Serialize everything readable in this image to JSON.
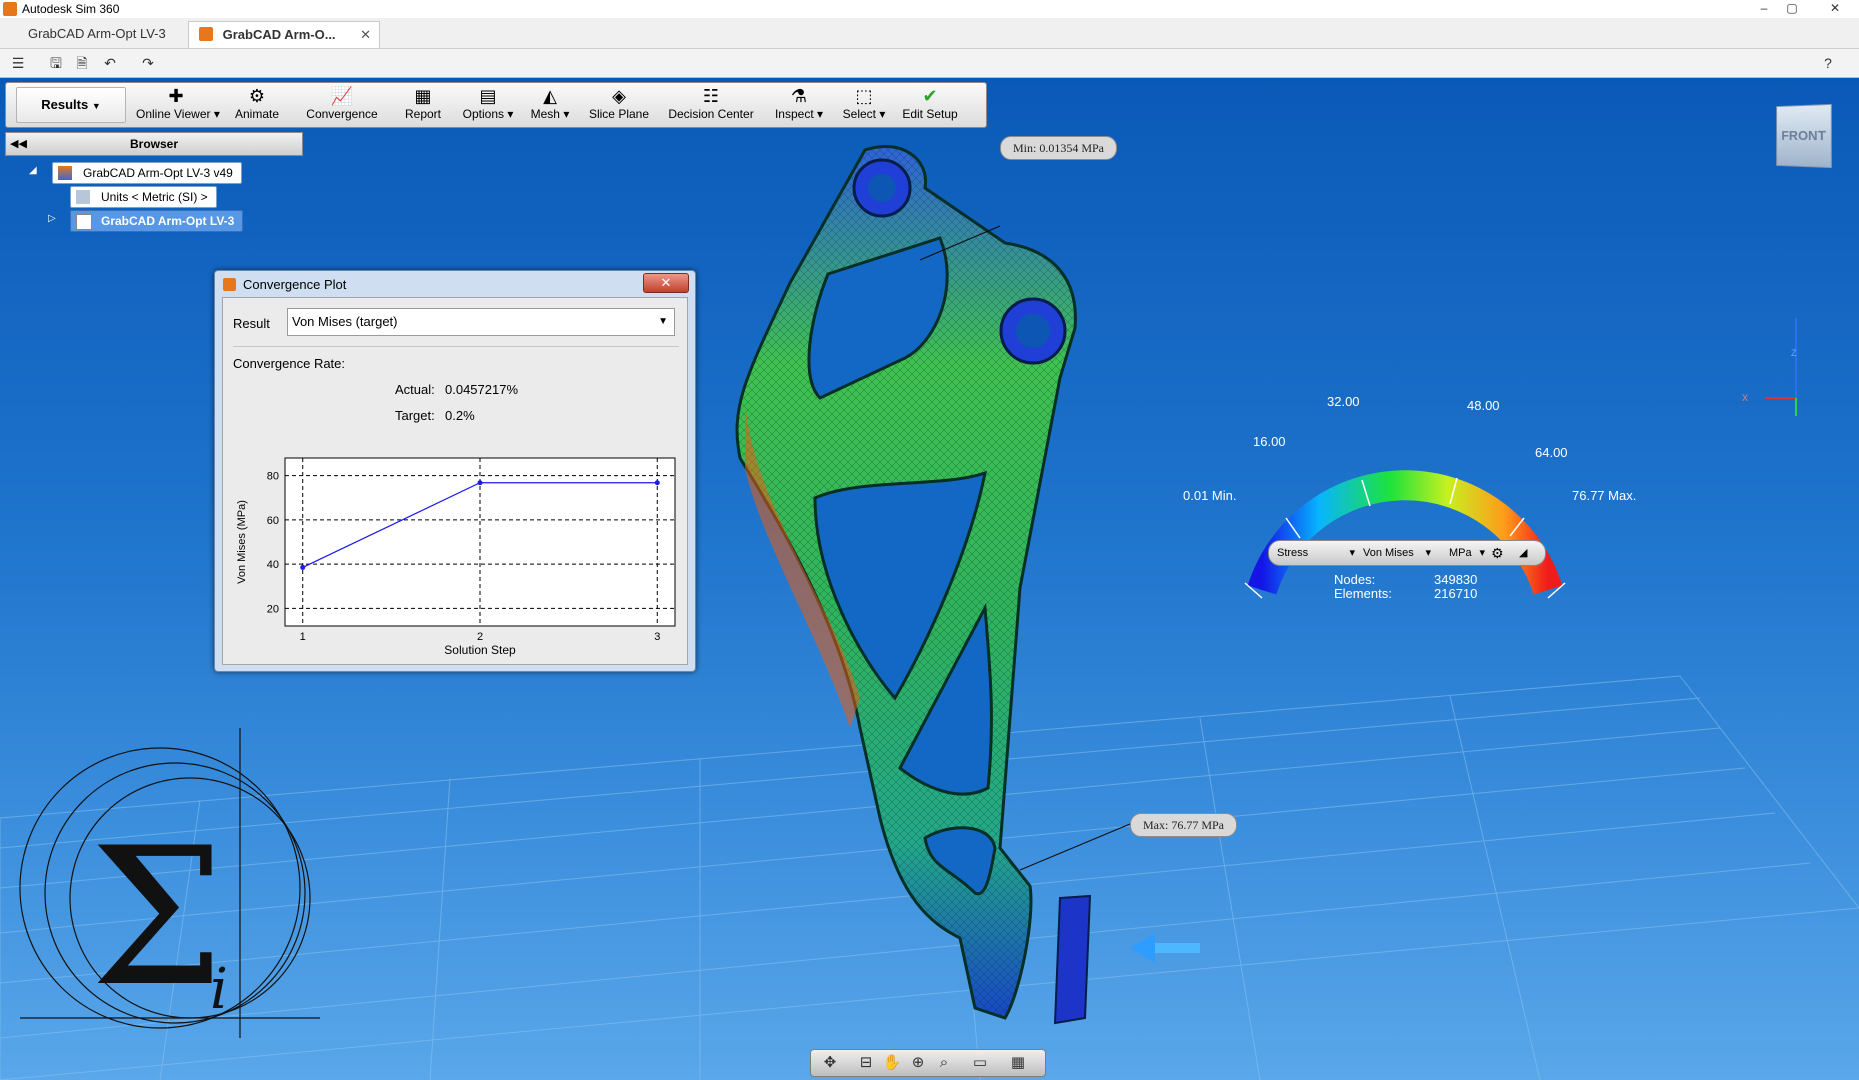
{
  "window": {
    "title": "Autodesk Sim 360",
    "controls": [
      "–",
      "▢",
      "✕"
    ]
  },
  "tabs": [
    {
      "label": "GrabCAD Arm-Opt LV-3",
      "active": false
    },
    {
      "label": "GrabCAD Arm-O...",
      "active": true,
      "close": "✕"
    }
  ],
  "qat": {
    "icons": [
      "menu-icon",
      "save-icon",
      "save-as-icon",
      "undo-icon",
      "redo-icon",
      "help-icon"
    ]
  },
  "ribbon": {
    "results_tab": "Results",
    "buttons": [
      {
        "label": "Online Viewer",
        "dropdown": true
      },
      {
        "label": "Animate"
      },
      {
        "label": "Convergence"
      },
      {
        "label": "Report"
      },
      {
        "label": "Options",
        "dropdown": true
      },
      {
        "label": "Mesh",
        "dropdown": true
      },
      {
        "label": "Slice Plane"
      },
      {
        "label": "Decision Center"
      },
      {
        "label": "Inspect",
        "dropdown": true
      },
      {
        "label": "Select",
        "dropdown": true
      },
      {
        "label": "Edit Setup"
      }
    ]
  },
  "browser": {
    "header": "Browser",
    "items": [
      {
        "label": "GrabCAD Arm-Opt LV-3 v49"
      },
      {
        "label": "Units < Metric (SI) >"
      },
      {
        "label": "GrabCAD Arm-Opt LV-3",
        "selected": true
      }
    ]
  },
  "convergence_dialog": {
    "title": "Convergence Plot",
    "result_label": "Result",
    "result_value": "Von Mises (target)",
    "rate_label": "Convergence Rate:",
    "actual_label": "Actual:",
    "actual_value": "0.0457217%",
    "target_label": "Target:",
    "target_value": "0.2%"
  },
  "chart_data": {
    "type": "line",
    "x": [
      1,
      2,
      3
    ],
    "series": [
      {
        "values": [
          38.5,
          76.8,
          76.8
        ]
      }
    ],
    "xlabel": "Solution Step",
    "ylabel": "Von Mises (MPa)",
    "xticks": [
      "1",
      "2",
      "3"
    ],
    "yticks": [
      80,
      60,
      40,
      20
    ],
    "xlim": [
      0.9,
      3.1
    ],
    "ylim": [
      12,
      88
    ],
    "grid": true,
    "line_color": "#1a1aee"
  },
  "legend": {
    "ticks": [
      "0.01 Min.",
      "16.00",
      "32.00",
      "48.00",
      "64.00",
      "76.77 Max."
    ],
    "result_type": "Stress",
    "component": "Von Mises",
    "unit": "MPa",
    "nodes_label": "Nodes:",
    "nodes_value": "349830",
    "elements_label": "Elements:",
    "elements_value": "216710"
  },
  "callouts": {
    "min": "Min: 0.01354 MPa",
    "max": "Max: 76.77 MPa"
  },
  "viewcube": {
    "face": "FRONT"
  },
  "triad": {
    "z": "Z",
    "x": "X"
  },
  "navbar": {
    "icons": [
      "pan-orbit-icon",
      "look-at-icon",
      "pan-icon",
      "zoom-icon",
      "zoom-window-icon",
      "display-icon",
      "grid-icon"
    ]
  },
  "colors": {
    "viewport_top": "#0a59b8",
    "viewport_bottom": "#5aa7ea",
    "accent": "#e8761a"
  }
}
